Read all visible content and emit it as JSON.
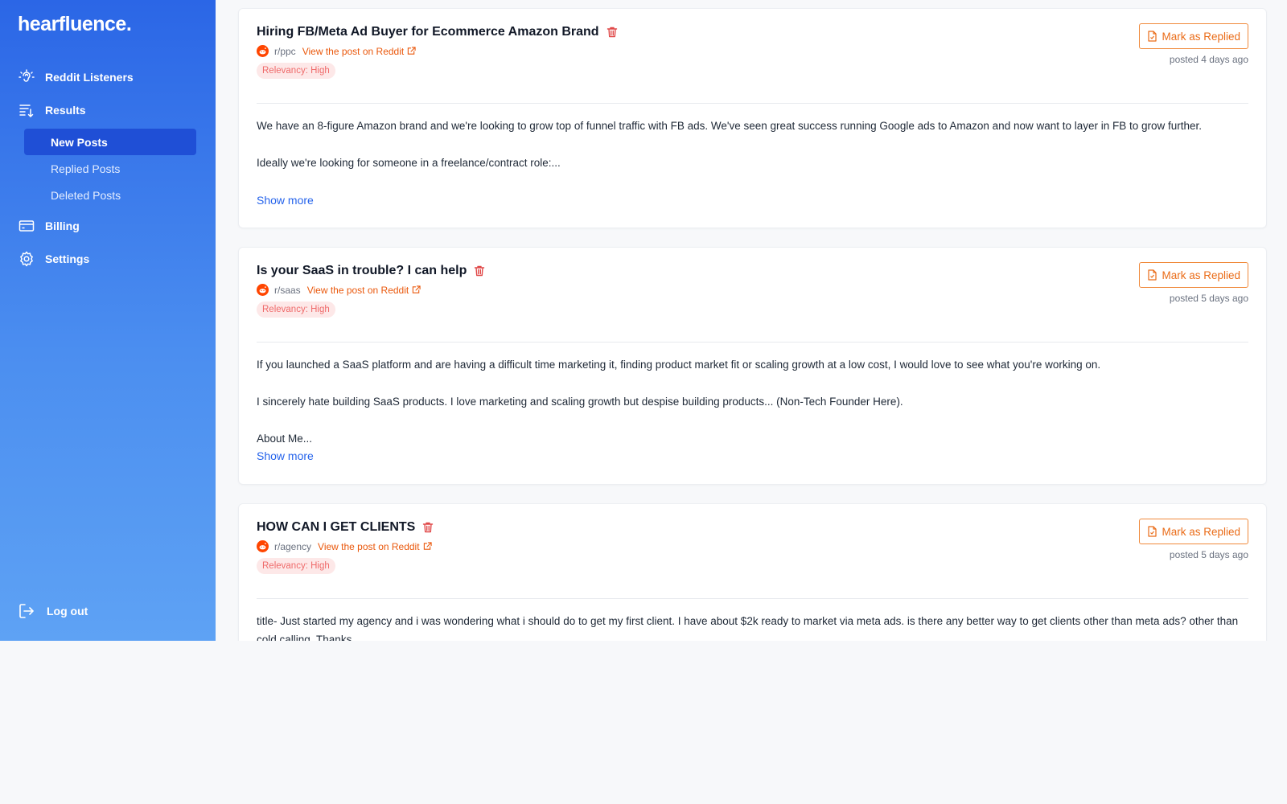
{
  "brand": {
    "name": "hearfluence."
  },
  "sidebar": {
    "items": [
      {
        "label": "Reddit Listeners",
        "icon": "ear-icon"
      },
      {
        "label": "Results",
        "icon": "sort-list-icon"
      },
      {
        "label": "Billing",
        "icon": "credit-card-icon"
      },
      {
        "label": "Settings",
        "icon": "gear-icon"
      }
    ],
    "results_subitems": [
      {
        "label": "New Posts",
        "active": true
      },
      {
        "label": "Replied Posts",
        "active": false
      },
      {
        "label": "Deleted Posts",
        "active": false
      }
    ],
    "logout_label": "Log out"
  },
  "posts": [
    {
      "title": "Hiring FB/Meta Ad Buyer for Ecommerce Amazon Brand",
      "subreddit": "r/ppc",
      "link_label": "View the post on Reddit",
      "relevancy": "Relevancy: High",
      "mark_label": "Mark as Replied",
      "posted": "posted 4 days ago",
      "paragraphs": [
        "We have an 8-figure Amazon brand and we're looking to grow top of funnel traffic with FB ads. We've seen great success running Google ads to Amazon and now want to layer in FB to grow further.",
        "Ideally we're looking for someone in a freelance/contract role:..."
      ],
      "show_more": "Show more"
    },
    {
      "title": "Is your SaaS in trouble? I can help",
      "subreddit": "r/saas",
      "link_label": "View the post on Reddit",
      "relevancy": "Relevancy: High",
      "mark_label": "Mark as Replied",
      "posted": "posted 5 days ago",
      "paragraphs": [
        "If you launched a SaaS platform and are having a difficult time marketing it, finding product market fit or scaling growth at a low cost, I would love to see what you're working on.",
        "I sincerely hate building SaaS products. I love marketing and scaling growth but despise building products... (Non-Tech Founder Here).",
        "About Me..."
      ],
      "show_more": "Show more"
    },
    {
      "title": "HOW CAN I GET CLIENTS",
      "subreddit": "r/agency",
      "link_label": "View the post on Reddit",
      "relevancy": "Relevancy: High",
      "mark_label": "Mark as Replied",
      "posted": "posted 5 days ago",
      "paragraphs": [
        "title- Just started my agency and i was wondering what i should do to get my first client. I have about $2k ready to market via meta ads. is there any better way to get clients other than meta ads? other than cold calling. Thanks"
      ]
    }
  ],
  "colors": {
    "sidebar_top": "#2b66e6",
    "sidebar_bottom": "#5ea2f4",
    "active_item": "#1f4fd6",
    "accent_orange": "#ea6c18",
    "link_blue": "#2563eb",
    "badge_bg": "#fde8e8",
    "badge_text": "#ef6a6a"
  }
}
